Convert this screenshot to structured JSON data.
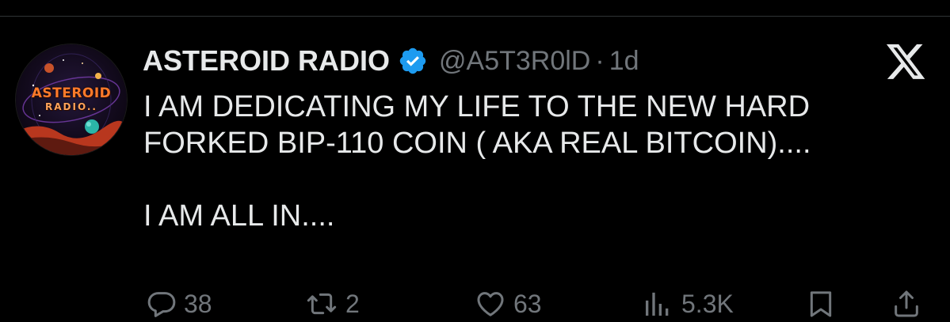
{
  "tweet": {
    "author_name": "ASTEROID RADIO",
    "handle": "@A5T3R0lD",
    "separator": "·",
    "time": "1d",
    "text_lines": [
      "I AM DEDICATING MY LIFE TO THE NEW HARD",
      "FORKED BIP-110 COIN ( AKA REAL BITCOIN)....",
      "I AM ALL IN...."
    ],
    "avatar_text": [
      "ASTEROID",
      "RADIO.."
    ]
  },
  "icons": {
    "verified": "verified-badge-icon",
    "brand": "x-logo-icon",
    "reply": "reply-icon",
    "retweet": "retweet-icon",
    "like": "heart-icon",
    "views": "views-icon",
    "bookmark": "bookmark-icon",
    "share": "share-icon"
  },
  "actions": {
    "replies": "38",
    "retweets": "2",
    "likes": "63",
    "views": "5.3K"
  },
  "colors": {
    "background": "#000000",
    "text": "#e7e9ea",
    "muted": "#71767b",
    "verified": "#1d9bf0",
    "divider": "#2f3336"
  }
}
